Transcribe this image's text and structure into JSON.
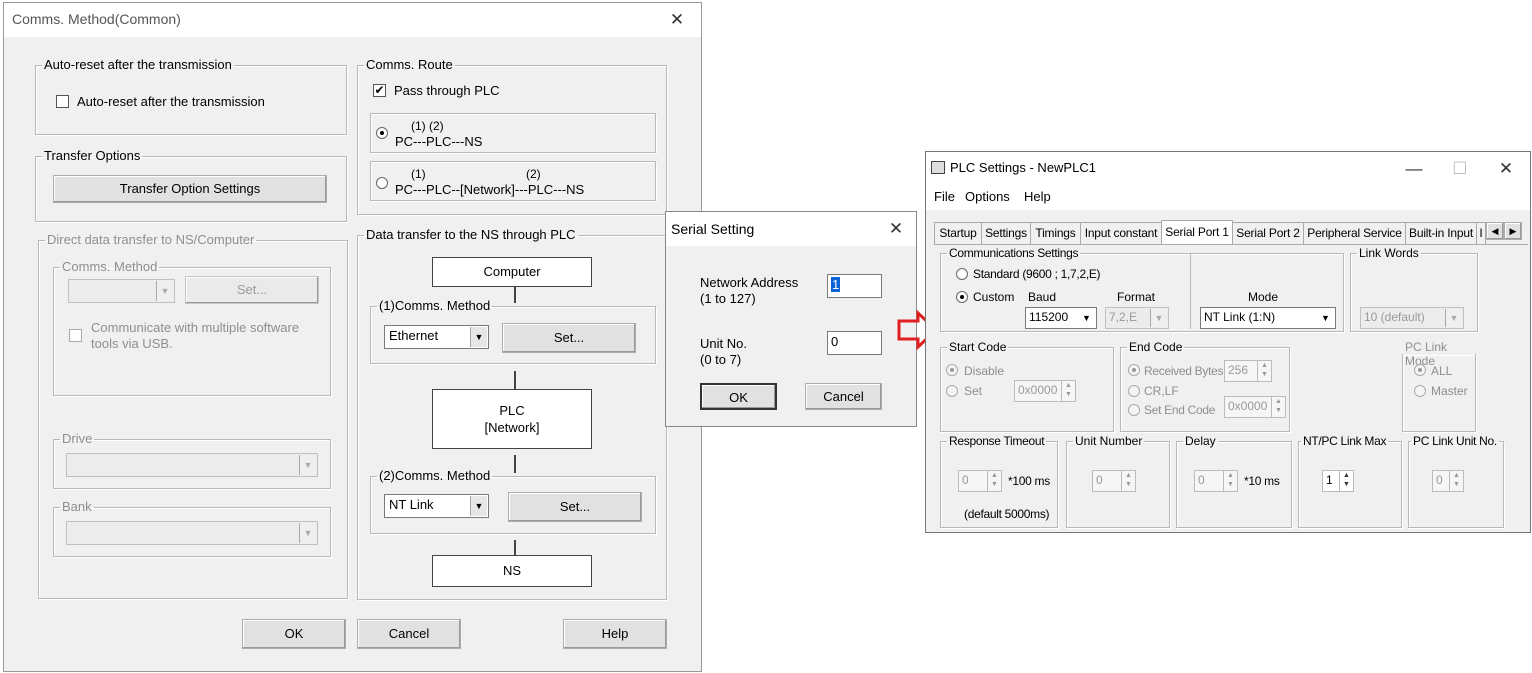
{
  "comms": {
    "title": "Comms. Method(Common)",
    "auto_reset": {
      "legend": "Auto-reset after the transmission",
      "checkbox_label": "Auto-reset after the transmission"
    },
    "transfer_options": {
      "legend": "Transfer Options",
      "button": "Transfer Option Settings"
    },
    "direct": {
      "legend": "Direct data transfer to NS/Computer",
      "comms_method_legend": "Comms. Method",
      "set_button": "Set...",
      "usb_label_1": "Communicate with multiple software",
      "usb_label_2": "tools via USB.",
      "drive_legend": "Drive",
      "bank_legend": "Bank"
    },
    "route": {
      "legend": "Comms. Route",
      "pass_through": "Pass through PLC",
      "opt1_nums": "(1)    (2)",
      "opt1_text": "PC---PLC---NS",
      "opt2_num1": "(1)",
      "opt2_num2": "(2)",
      "opt2_text": "PC---PLC--[Network]---PLC---NS"
    },
    "data_transfer": {
      "legend": "Data transfer to the NS through PLC",
      "computer": "Computer",
      "method1_legend": "(1)Comms. Method",
      "method1_value": "Ethernet",
      "set1": "Set...",
      "plc_line1": "PLC",
      "plc_line2": "[Network]",
      "method2_legend": "(2)Comms. Method",
      "method2_value": "NT Link",
      "set2": "Set...",
      "ns": "NS"
    },
    "buttons": {
      "ok": "OK",
      "cancel": "Cancel",
      "help": "Help"
    }
  },
  "serial": {
    "title": "Serial Setting",
    "network_address_label": "Network Address",
    "network_address_range": "(1 to 127)",
    "network_address_value": "1",
    "unit_no_label": "Unit No.",
    "unit_no_range": "(0 to 7)",
    "unit_no_value": "0",
    "ok": "OK",
    "cancel": "Cancel"
  },
  "plc": {
    "title": "PLC Settings - NewPLC1",
    "menu": [
      "File",
      "Options",
      "Help"
    ],
    "tabs": [
      "Startup",
      "Settings",
      "Timings",
      "Input constant",
      "Serial Port 1",
      "Serial Port 2",
      "Peripheral Service",
      "Built-in Input",
      "I"
    ],
    "comm_settings": {
      "legend": "Communications Settings",
      "standard": "Standard (9600 ; 1,7,2,E)",
      "custom": "Custom",
      "baud_label": "Baud",
      "baud_value": "115200",
      "format_label": "Format",
      "format_value": "7,2,E",
      "mode_label": "Mode",
      "mode_value": "NT Link (1:N)"
    },
    "link_words": {
      "legend": "Link Words",
      "value": "10 (default)"
    },
    "start_code": {
      "legend": "Start Code",
      "disable": "Disable",
      "set": "Set",
      "value": "0x0000"
    },
    "end_code": {
      "legend": "End Code",
      "received": "Received Bytes",
      "received_value": "256",
      "crlf": "CR,LF",
      "set_end": "Set End Code",
      "set_end_value": "0x0000"
    },
    "pc_link_mode": {
      "legend": "PC Link Mode",
      "all": "ALL",
      "master": "Master"
    },
    "response_timeout": {
      "legend": "Response Timeout",
      "value": "0",
      "unit": "*100 ms",
      "default": "(default 5000ms)"
    },
    "unit_number": {
      "legend": "Unit Number",
      "value": "0"
    },
    "delay": {
      "legend": "Delay",
      "value": "0",
      "unit": "*10 ms"
    },
    "nt_pc_link_max": {
      "legend": "NT/PC Link Max",
      "value": "1"
    },
    "pc_link_unit_no": {
      "legend": "PC Link Unit No.",
      "value": "0"
    }
  },
  "arrow_color": "#e02020"
}
